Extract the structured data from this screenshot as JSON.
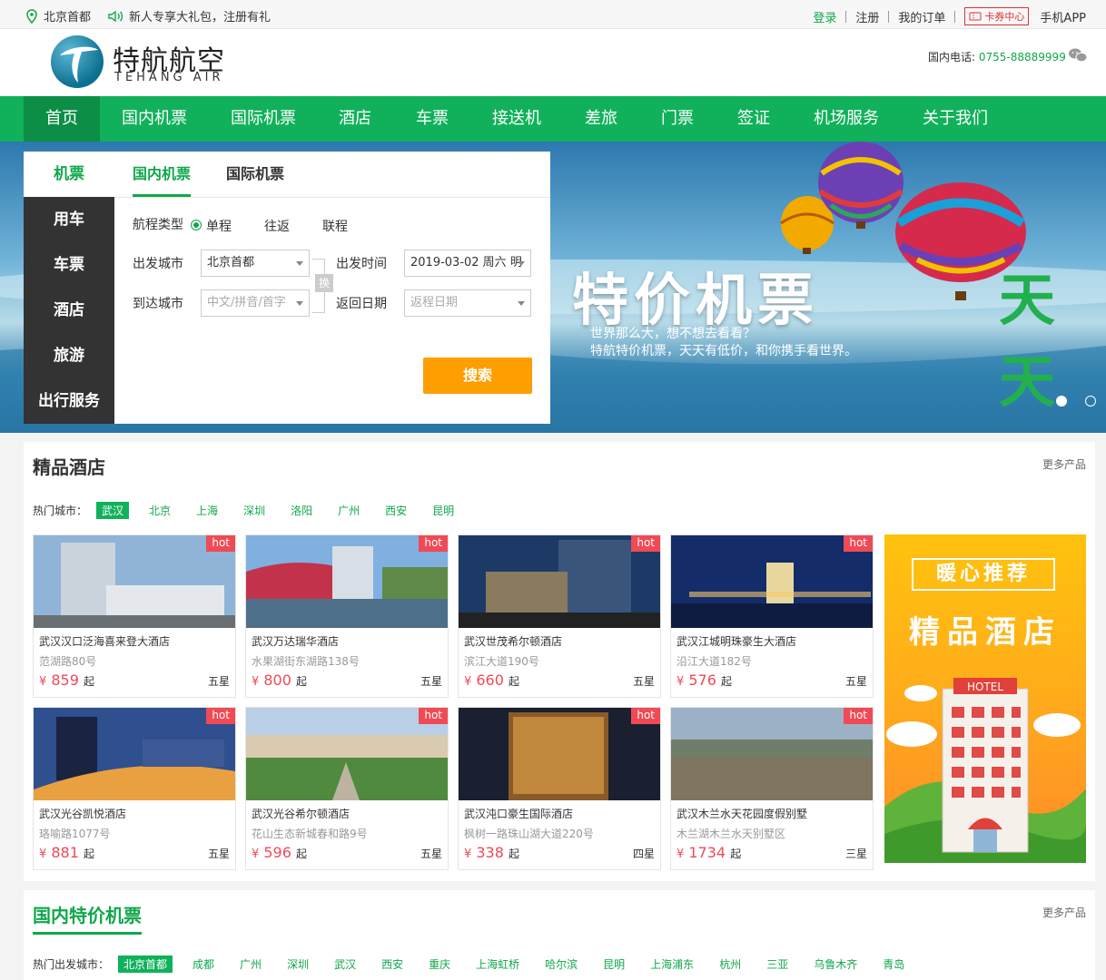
{
  "topbar": {
    "location": "北京首都",
    "promo": "新人专享大礼包，注册有礼",
    "login": "登录",
    "register": "注册",
    "orders": "我的订单",
    "coupon": "卡券中心",
    "app": "手机APP"
  },
  "header": {
    "logo_cn": "特航航空",
    "logo_en": "TEHANG AIR",
    "hotline_label": "国内电话:",
    "hotline_number": "0755-88889999"
  },
  "nav": {
    "items": [
      "首页",
      "国内机票",
      "国际机票",
      "酒店",
      "车票",
      "接送机",
      "差旅",
      "门票",
      "签证",
      "机场服务",
      "关于我们"
    ]
  },
  "banner": {
    "title": "特价机票",
    "title2": "天天",
    "sub1": "世界那么大，想不想去看看？",
    "sub2": "特航特价机票，天天有低价，和你携手看世界。"
  },
  "search": {
    "side": [
      "机票",
      "用车",
      "车票",
      "酒店",
      "旅游",
      "出行服务"
    ],
    "tabs": [
      "国内机票",
      "国际机票"
    ],
    "trip_type_label": "航程类型",
    "trip_types": [
      "单程",
      "往返",
      "联程"
    ],
    "from_label": "出发城市",
    "from_value": "北京首都",
    "to_label": "到达城市",
    "to_placeholder": "中文/拼音/首字",
    "swap": "换",
    "depart_label": "出发时间",
    "depart_value": "2019-03-02 周六 明",
    "return_label": "返回日期",
    "return_placeholder": "返程日期",
    "button": "搜索"
  },
  "hotels": {
    "title": "精品酒店",
    "more": "更多产品",
    "cities_label": "热门城市：",
    "cities": [
      "武汉",
      "北京",
      "上海",
      "深圳",
      "洛阳",
      "广州",
      "西安",
      "昆明"
    ],
    "hot": "hot",
    "currency": "¥",
    "from": "起",
    "items": [
      {
        "name": "武汉汉口泛海喜来登大酒店",
        "addr": "范湖路80号",
        "price": "859",
        "star": "五星"
      },
      {
        "name": "武汉万达瑞华酒店",
        "addr": "水果湖街东湖路138号",
        "price": "800",
        "star": "五星"
      },
      {
        "name": "武汉世茂希尔顿酒店",
        "addr": "滨江大道190号",
        "price": "660",
        "star": "五星"
      },
      {
        "name": "武汉江城明珠豪生大酒店",
        "addr": "沿江大道182号",
        "price": "576",
        "star": "五星"
      },
      {
        "name": "武汉光谷凯悦酒店",
        "addr": "珞喻路1077号",
        "price": "881",
        "star": "五星"
      },
      {
        "name": "武汉光谷希尔顿酒店",
        "addr": "花山生态新城春和路9号",
        "price": "596",
        "star": "五星"
      },
      {
        "name": "武汉沌口豪生国际酒店",
        "addr": "枫树一路珠山湖大道220号",
        "price": "338",
        "star": "四星"
      },
      {
        "name": "武汉木兰水天花园度假别墅",
        "addr": "木兰湖木兰水天别墅区",
        "price": "1734",
        "star": "三星"
      }
    ],
    "ad_line1": "暖心推荐",
    "ad_line2": "精品酒店",
    "ad_sign": "HOTEL"
  },
  "flights": {
    "title": "国内特价机票",
    "more": "更多产品",
    "cities_label": "热门出发城市：",
    "cities": [
      "北京首都",
      "成都",
      "广州",
      "深圳",
      "武汉",
      "西安",
      "重庆",
      "上海虹桥",
      "哈尔滨",
      "昆明",
      "上海浦东",
      "杭州",
      "三亚",
      "乌鲁木齐",
      "青岛"
    ]
  },
  "colors": {
    "brand_green": "#10b15a",
    "nav_active": "#0c8e47",
    "search_button": "#ff9e00",
    "hot_badge": "#f04a55"
  }
}
